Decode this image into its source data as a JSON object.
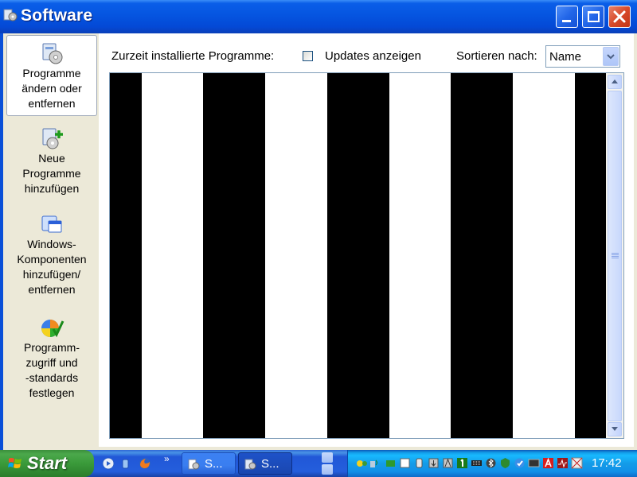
{
  "window": {
    "title": "Software",
    "title_icon": "add-remove-programs-icon"
  },
  "nav": {
    "items": [
      {
        "label": "Programme\nändern oder\nentfernen",
        "icon": "change-remove-programs-icon",
        "active": true
      },
      {
        "label": "Neue\nProgramme\nhinzufügen",
        "icon": "add-new-programs-icon",
        "active": false
      },
      {
        "label": "Windows-\nKomponenten\nhinzufügen/\nentfernen",
        "icon": "windows-components-icon",
        "active": false
      },
      {
        "label": "Programm-\nzugriff und\n-standards\nfestlegen",
        "icon": "program-access-defaults-icon",
        "active": false
      }
    ]
  },
  "content": {
    "installed_label": "Zurzeit installierte Programme:",
    "show_updates_label": "Updates anzeigen",
    "show_updates_checked": false,
    "sort_label": "Sortieren nach:",
    "sort_value": "Name"
  },
  "taskbar": {
    "start_label": "Start",
    "quicklaunch_icons": [
      "media-player-icon",
      "volume-icon",
      "firefox-icon"
    ],
    "chevron": "»",
    "tasks": [
      {
        "label": "S...",
        "icon": "explorer-icon",
        "active": false
      },
      {
        "label": "S...",
        "icon": "add-remove-programs-icon",
        "active": true
      }
    ],
    "clock": "17:42"
  },
  "colors": {
    "titlebar": "#0555e0",
    "close_button": "#d84a2a",
    "nav_bg": "#ece9d8",
    "start_green": "#3a9a3a",
    "tray_blue": "#139ce8",
    "stripe": "#000000"
  }
}
